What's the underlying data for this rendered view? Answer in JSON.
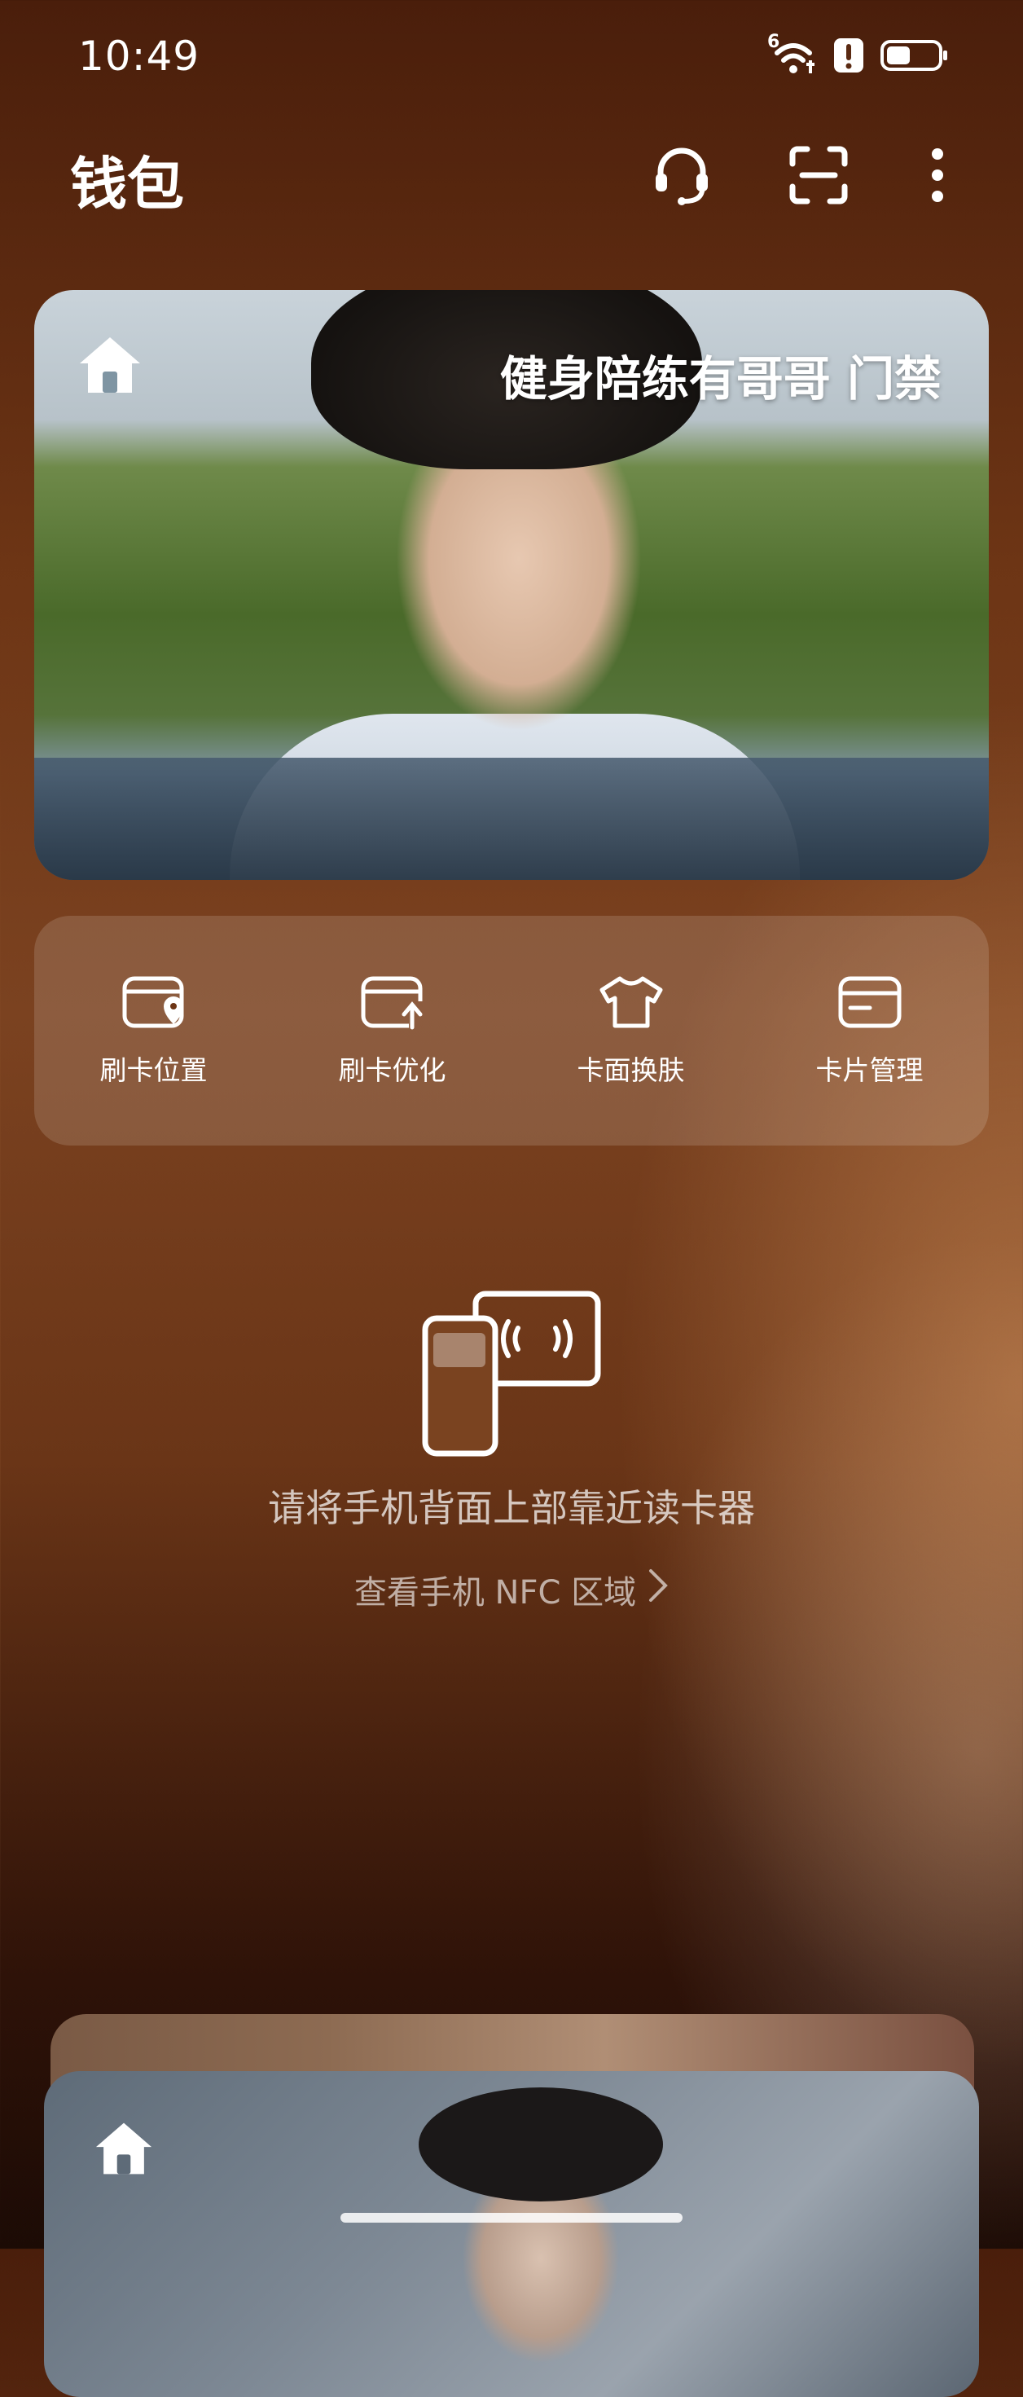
{
  "status_bar": {
    "time": "10:49",
    "signal_superscript": "6",
    "icons": [
      "wifi-icon",
      "alert-icon",
      "battery-icon"
    ]
  },
  "header": {
    "title": "钱包",
    "icons": [
      "headset-icon",
      "scan-icon",
      "more-icon"
    ]
  },
  "main_card": {
    "title": "健身陪练有哥哥 门禁",
    "icon": "home-icon"
  },
  "actions": [
    {
      "label": "刷卡位置",
      "icon": "card-location-icon"
    },
    {
      "label": "刷卡优化",
      "icon": "card-optimize-icon"
    },
    {
      "label": "卡面换肤",
      "icon": "shirt-icon"
    },
    {
      "label": "卡片管理",
      "icon": "card-manage-icon"
    }
  ],
  "nfc": {
    "hint": "请将手机背面上部靠近读卡器",
    "link": "查看手机 NFC 区域",
    "icon": "nfc-illustration-icon"
  },
  "bottom_cards": {
    "icon": "home-icon"
  },
  "colors": {
    "accent": "#ffffff",
    "background_top": "#4a1e0b",
    "background_mid": "#7b4220"
  }
}
